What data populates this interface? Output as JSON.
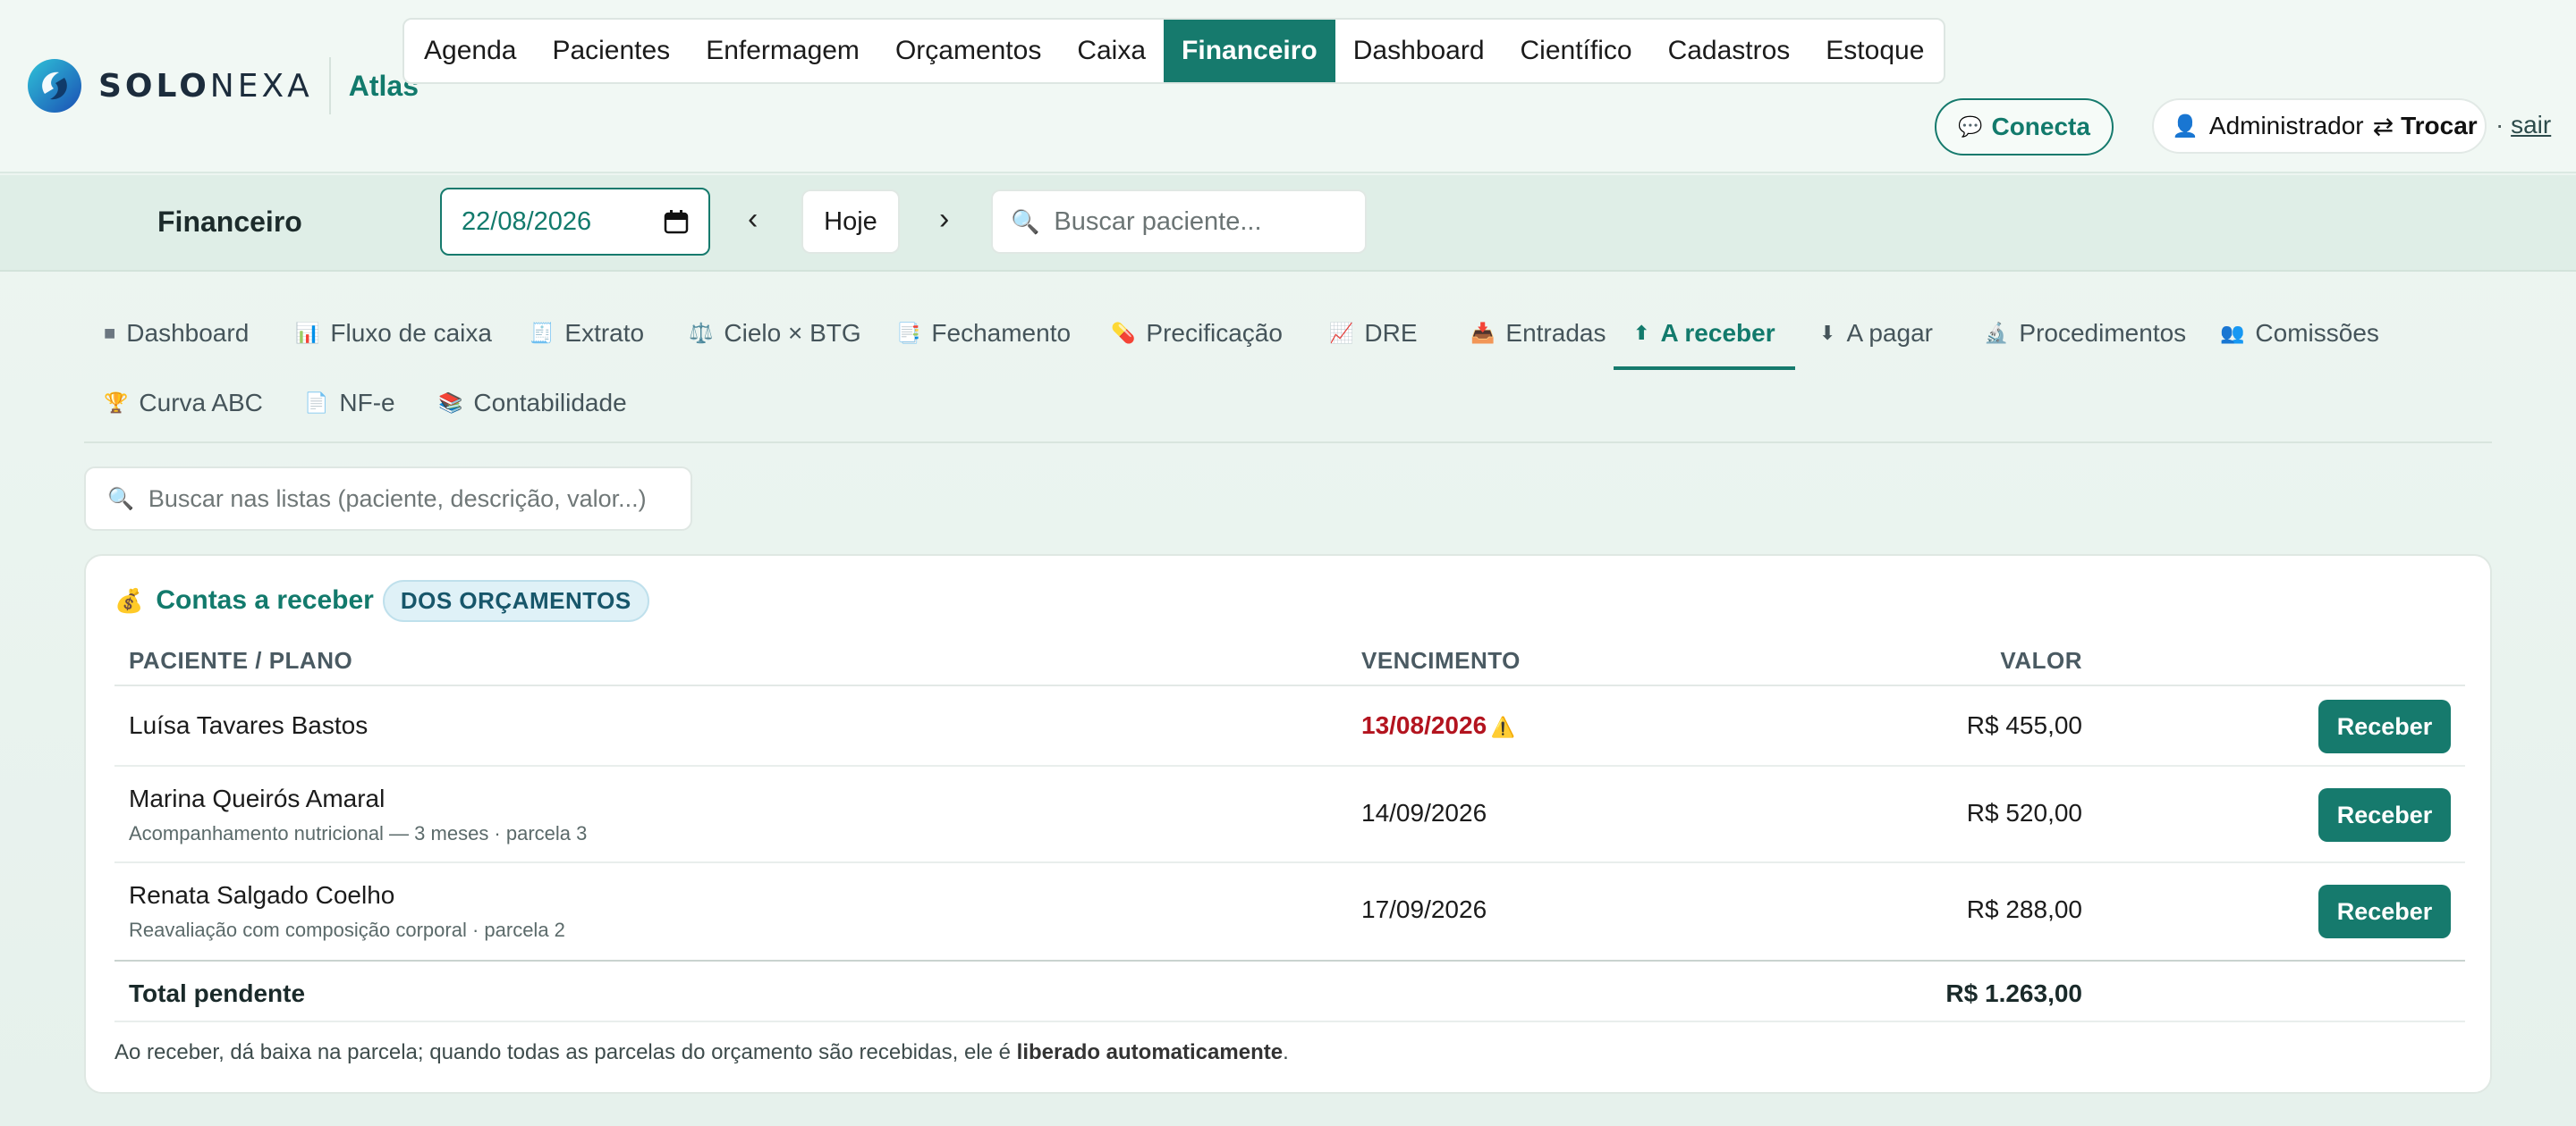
{
  "brand": {
    "name_bold": "SOLO",
    "name_light": "NEXA",
    "product": "Atlas"
  },
  "main_nav": [
    {
      "label": "Agenda",
      "active": false
    },
    {
      "label": "Pacientes",
      "active": false
    },
    {
      "label": "Enfermagem",
      "active": false
    },
    {
      "label": "Orçamentos",
      "active": false
    },
    {
      "label": "Caixa",
      "active": false
    },
    {
      "label": "Financeiro",
      "active": true
    },
    {
      "label": "Dashboard",
      "active": false
    },
    {
      "label": "Científico",
      "active": false
    },
    {
      "label": "Cadastros",
      "active": false
    },
    {
      "label": "Estoque",
      "active": false
    }
  ],
  "header": {
    "conecta_label": "Conecta",
    "user_name": "Administrador",
    "switch_symbol": "⇄",
    "switch_label": "Trocar",
    "separator": "·",
    "logout_label": "sair"
  },
  "subbar": {
    "title": "Financeiro",
    "date": "22/08/2026",
    "prev": "‹",
    "today": "Hoje",
    "next": "›",
    "patient_search_placeholder": "Buscar paciente..."
  },
  "tabs": [
    {
      "icon": "■",
      "label": "Dashboard",
      "active": false
    },
    {
      "icon": "📊",
      "label": "Fluxo de caixa",
      "active": false
    },
    {
      "icon": "🧾",
      "label": "Extrato",
      "active": false
    },
    {
      "icon": "⚖️",
      "label": "Cielo × BTG",
      "active": false
    },
    {
      "icon": "📑",
      "label": "Fechamento",
      "active": false
    },
    {
      "icon": "💊",
      "label": "Precificação",
      "active": false
    },
    {
      "icon": "📈",
      "label": "DRE",
      "active": false
    },
    {
      "icon": "📥",
      "label": "Entradas",
      "active": false
    },
    {
      "icon": "⬆",
      "label": "A receber",
      "active": true
    },
    {
      "icon": "⬇",
      "label": "A pagar",
      "active": false
    },
    {
      "icon": "🔬",
      "label": "Procedimentos",
      "active": false
    },
    {
      "icon": "👥",
      "label": "Comissões",
      "active": false
    },
    {
      "icon": "🏆",
      "label": "Curva ABC",
      "active": false
    },
    {
      "icon": "📄",
      "label": "NF-e",
      "active": false
    },
    {
      "icon": "📚",
      "label": "Contabilidade",
      "active": false
    }
  ],
  "list_search_placeholder": "Buscar nas listas (paciente, descrição, valor...)",
  "receivables": {
    "icon": "💰",
    "title": "Contas a receber",
    "badge": "DOS ORÇAMENTOS",
    "columns": {
      "patient": "PACIENTE / PLANO",
      "due": "VENCIMENTO",
      "value": "VALOR"
    },
    "rows": [
      {
        "patient": "Luísa Tavares Bastos",
        "plan": "",
        "due": "13/08/2026",
        "overdue": true,
        "warning": "⚠️",
        "value": "R$ 455,00",
        "action": "Receber"
      },
      {
        "patient": "Marina Queirós Amaral",
        "plan": "Acompanhamento nutricional — 3 meses · parcela 3",
        "due": "14/09/2026",
        "overdue": false,
        "warning": "",
        "value": "R$ 520,00",
        "action": "Receber"
      },
      {
        "patient": "Renata Salgado Coelho",
        "plan": "Reavaliação com composição corporal · parcela 2",
        "due": "17/09/2026",
        "overdue": false,
        "warning": "",
        "value": "R$ 288,00",
        "action": "Receber"
      }
    ],
    "total_label": "Total pendente",
    "total_value": "R$ 1.263,00",
    "footnote_prefix": "Ao receber, dá baixa na parcela; quando todas as parcelas do orçamento são recebidas, ele é ",
    "footnote_bold": "liberado automaticamente",
    "footnote_suffix": "."
  },
  "colors": {
    "accent": "#167a6d",
    "overdue": "#b3141f",
    "badge_bg": "#dff1f7"
  }
}
